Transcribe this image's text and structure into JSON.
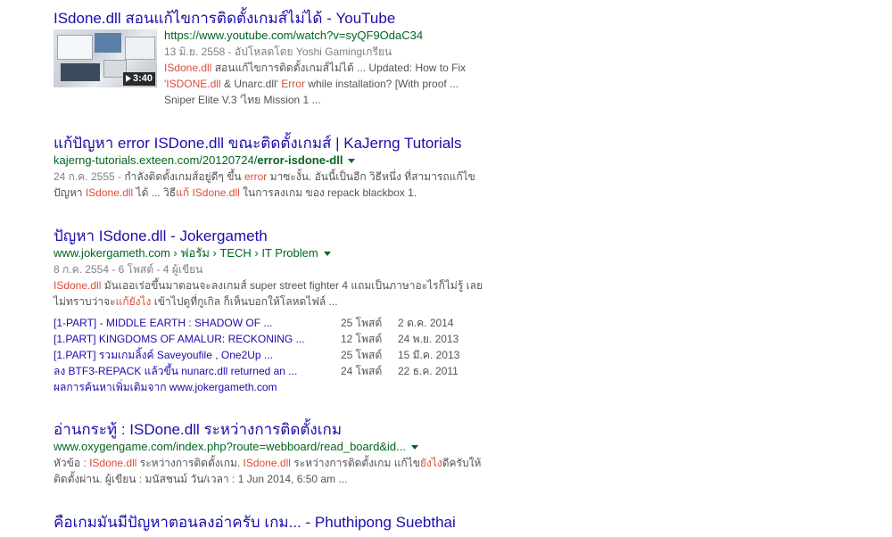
{
  "results": [
    {
      "title": "ISdone.dll สอนแก้ไขการติดตั้งเกมส์ไม่ได้ - YouTube",
      "url": "https://www.youtube.com/watch?v=syQF9OdaC34",
      "meta": "13 มิ.ย. 2558 - อัปโหลดโดย Yoshi Gamingเกรียน",
      "thumb_duration": "3:40",
      "snippet": {
        "l1_em1": "ISdone.dll",
        "l1_rest": " สอนแก้ไขการติดตั้งเกมส์ไม่ได้ ... Updated: How to Fix",
        "l2_em1": "'ISDONE.dll",
        "l2_mid": " & Unarc.dll' ",
        "l2_em2": "Error",
        "l2_rest": " while installation? [With proof ...",
        "l3": "Sniper Elite V.3 'ไทย Mission 1 ..."
      }
    },
    {
      "title": "แก้ปัญหา error ISDone.dll ขณะติดตั้งเกมส์ | KaJerng Tutorials",
      "url_plain": "kajerng-tutorials.exteen.com/20120724/",
      "url_bold": "error-isdone-dll",
      "snippet": {
        "meta": "24 ก.ค. 2555 - ",
        "l1_a": "กำลังติดตั้งเกมส์อยู่ดีๆ ขึ้น ",
        "l1_em": "error",
        "l1_b": " มาซะงั้น. อันนี้เป็นอีก วิธีหนึ่ง ที่สามารถแก้ไข",
        "l2_a": "ปัญหา ",
        "l2_em1": "ISdone.dll",
        "l2_b": " ได้ ... วิธี",
        "l2_em2": "แก้ ISdone.dll",
        "l2_c": " ในการลงเกม ของ repack blackbox 1."
      }
    },
    {
      "title": "ปัญหา ISdone.dll - Jokergameth",
      "url": "www.jokergameth.com › ฟอรัม › TECH › IT Problem",
      "meta": "8 ก.ค. 2554 - 6 โพสต์ - 4 ผู้เขียน",
      "snippet": {
        "l1_em": "ISdone.dll",
        "l1_rest": " มันเออเร่อขึ้นมาตอนจะลงเกมส์ super street fighter 4 แถมเป็นภาษาอะไรก็ไม่รู้ เลย",
        "l2_a": "ไม่ทราบว่าจะ",
        "l2_em": "แก้ยังไง",
        "l2_b": " เข้าไปดูที่กูเกิล ก็เห็นบอกให้โลหดไฟล์ ..."
      },
      "sitelinks": [
        {
          "title": "[1-PART] - MIDDLE EARTH : SHADOW OF ...",
          "count": "25 โพสต์",
          "date": "2 ต.ค. 2014"
        },
        {
          "title": "[1.PART] KINGDOMS OF AMALUR: RECKONING ...",
          "count": "12 โพสต์",
          "date": "24 พ.ย. 2013"
        },
        {
          "title": "[1.PART] รวมเกมลิ้งค์ Saveyoufile , One2Up ...",
          "count": "25 โพสต์",
          "date": "15 มี.ค. 2013"
        },
        {
          "title": "ลง BTF3-REPACK แล้วขึ้น nunarc.dll returned an ...",
          "count": "24 โพสต์",
          "date": "22 ธ.ค. 2011"
        }
      ],
      "more": "ผลการค้นหาเพิ่มเติมจาก www.jokergameth.com"
    },
    {
      "title": "อ่านกระทู้ : ISDone.dll ระหว่างการติดตั้งเกม",
      "url": "www.oxygengame.com/index.php?route=webboard/read_board&id...",
      "snippet": {
        "l1_a": "หัวข้อ : ",
        "l1_em1": "ISdone.dll",
        "l1_b": " ระหว่างการติดตั้งเกม. ",
        "l1_em2": "ISdone.dll",
        "l1_c": " ระหว่างการติดตั้งเกม แก้ไข",
        "l1_em3": "ยังไง",
        "l1_d": "ดีครับให้",
        "l2": "ติดตั้งผ่าน. ผู้เขียน : มนัสชนม์ วัน/เวลา : 1 Jun 2014, 6:50 am ..."
      }
    },
    {
      "title": "คือเกมมันมีปัญหาตอนลงอ่าครับ เกม... - Phuthipong Suebthai"
    }
  ]
}
